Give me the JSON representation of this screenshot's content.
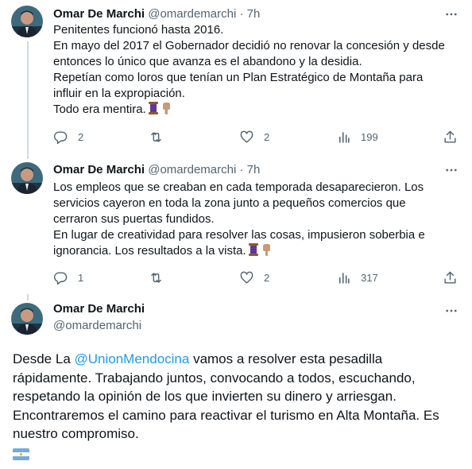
{
  "tweets": [
    {
      "author_name": "Omar De Marchi",
      "author_handle": "@omardemarchi",
      "separator": "·",
      "time": "7h",
      "lines": [
        "Penitentes funcionó hasta 2016.",
        "En mayo del 2017 el Gobernador decidió no renovar la concesión y desde",
        "entonces lo único que avanza es el abandono y la desidia.",
        "Repetían como loros que tenían un Plan Estratégico de Montaña para",
        "influir en la expropiación.",
        "Todo era mentira."
      ],
      "emojis": [
        "thread-spool-emoji",
        "pointing-down-emoji"
      ],
      "replies": "2",
      "retweets": "",
      "likes": "2",
      "views": "199"
    },
    {
      "author_name": "Omar De Marchi",
      "author_handle": "@omardemarchi",
      "separator": "·",
      "time": "7h",
      "lines": [
        "Los empleos que se creaban en cada temporada desaparecieron. Los",
        "servicios cayeron en toda la zona junto a pequeños comercios que",
        "cerraron sus puertas fundidos.",
        "En lugar de creatividad para resolver las cosas, impusieron soberbia e",
        "ignorancia. Los resultados a la vista."
      ],
      "emojis": [
        "thread-spool-emoji",
        "pointing-down-emoji"
      ],
      "replies": "1",
      "retweets": "",
      "likes": "2",
      "views": "317"
    }
  ],
  "main_tweet": {
    "author_name": "Omar De Marchi",
    "author_handle": "@omardemarchi",
    "line1_prefix": "Desde La ",
    "mention": "@UnionMendocina",
    "line1_suffix": " vamos a resolver esta pesadilla",
    "lines": [
      "rápidamente. Trabajando juntos, convocando a todos, escuchando,",
      "respetando la opinión de los que invierten su dinero y arriesgan.",
      "Encontraremos el camino para reactivar el turismo en Alta Montaña. Es",
      "nuestro compromiso."
    ],
    "flag": "argentina-flag-emoji"
  },
  "colors": {
    "text": "#0f1419",
    "secondary": "#536471",
    "link": "#1d9bf0",
    "divider": "#eff3f4",
    "thread_line": "#cfd9de"
  }
}
